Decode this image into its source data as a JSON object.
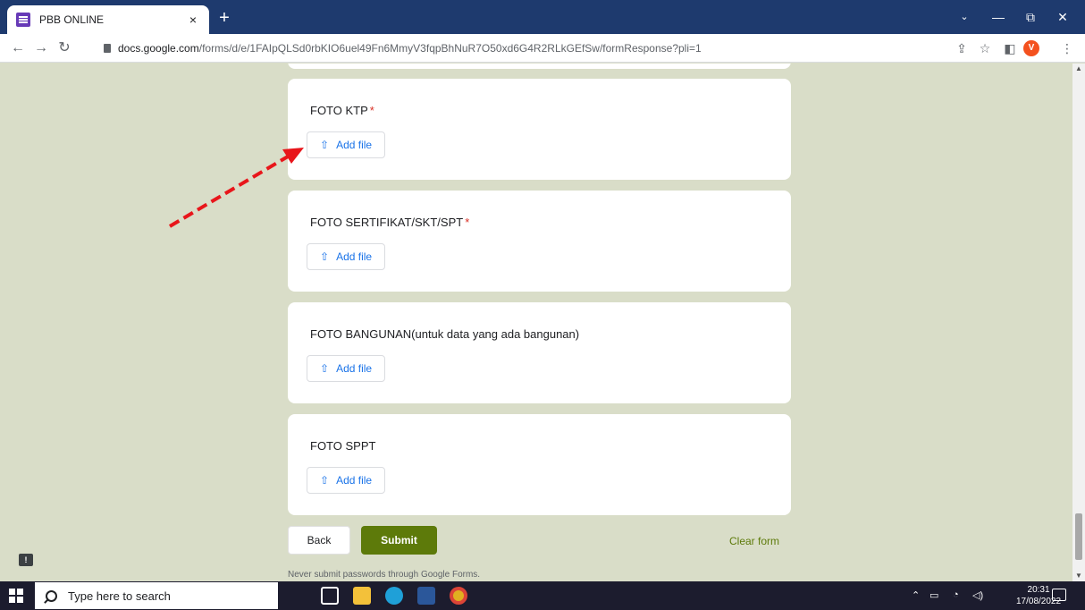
{
  "browser": {
    "tab_title": "PBB ONLINE",
    "tab_close": "×",
    "new_tab": "+",
    "url_host": "docs.google.com",
    "url_path": "/forms/d/e/1FAIpQLSd0rbKIO6uel49Fn6MmyV3fqpBhNuR7O50xd6G4R2RLkGEfSw/formResponse?pli=1",
    "profile_initial": "V",
    "minimize": "—",
    "maximize": "⧉",
    "close": "✕",
    "tab_search": "⌄"
  },
  "form": {
    "questions": [
      {
        "label": "FOTO KTP",
        "required": "*",
        "button": "Add file"
      },
      {
        "label": "FOTO SERTIFIKAT/SKT/SPT",
        "required": "*",
        "button": "Add file"
      },
      {
        "label": "FOTO BANGUNAN(untuk data yang ada bangunan)",
        "required": "",
        "button": "Add file"
      },
      {
        "label": "FOTO SPPT",
        "required": "",
        "button": "Add file"
      }
    ],
    "back_label": "Back",
    "submit_label": "Submit",
    "clear_label": "Clear form",
    "warning": "Never submit passwords through Google Forms.",
    "accent_color": "#5d7a0a",
    "annotation_arrow_color": "#e8161b"
  },
  "taskbar": {
    "search_placeholder": "Type here to search",
    "time": "20:31",
    "date": "17/08/2022"
  }
}
